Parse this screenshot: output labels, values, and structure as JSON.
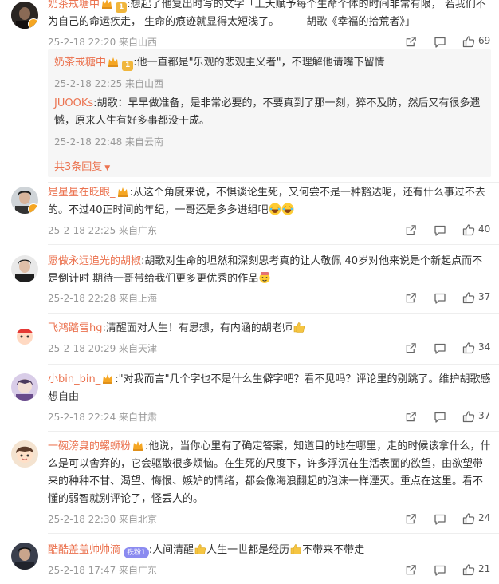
{
  "colors": {
    "username": "#eb7350",
    "meta": "#999999",
    "reply_bg": "#f6f6f6",
    "badge": "#f0b63c"
  },
  "comments": [
    {
      "username": "奶茶戒糖中",
      "badge": "1",
      "text": ":想起了他复出时写的文字「上天赋予每个生命个体的时间非常有限， 若我们不为自己的命运疾走， 生命的痕迹就显得太短浅了。 —— 胡歌《幸福的拾荒者》」",
      "meta": "25-2-18 22:20 来自山西",
      "likes": "69",
      "replies": [
        {
          "username": "奶茶戒糖中",
          "badge": "1",
          "text": ":他一直都是\"乐观的悲观主义者\"，不理解他请嘴下留情",
          "meta": "25-2-18 22:25 来自山西"
        },
        {
          "username": "JUOOKs",
          "text": ":胡歌：早早做准备，是非常必要的，不要真到了那一刻，猝不及防，然后又有很多遗憾，原来人生有好多事都没干成。",
          "meta": "25-2-18 22:48 来自云南"
        }
      ],
      "more_replies": "共3条回复"
    },
    {
      "username": "是星星在眨眼_",
      "text": ":从这个角度来说，不惧谈论生死，又何尝不是一种豁达呢，还有什么事过不去的。不过40正时间的年纪，一哥还是多多进组吧",
      "meta": "25-2-18 22:25 来自广东",
      "likes": "40"
    },
    {
      "username": "愿做永远追光的胡椒",
      "text": ":胡歌对生命的坦然和深刻思考真的让人敬佩 40岁对他来说是个新起点而不是倒计时 期待一哥带给我们更多更优秀的作品",
      "meta": "25-2-18 22:28 来自上海",
      "likes": "37"
    },
    {
      "username": "飞鸿踏雪hg",
      "text": ":清醒面对人生！有思想，有内涵的胡老师",
      "meta": "25-2-18 20:29 来自天津",
      "likes": "34"
    },
    {
      "username": "小bin_bin_",
      "text": ":\"对我而言\"几个字也不是什么生僻字吧？看不见吗？评论里的别跳了。维护胡歌感想自由",
      "meta": "25-2-18 22:24 来自甘肃",
      "likes": "37"
    },
    {
      "username": "一碗滂臭的螺蛳粉",
      "text": ":他说，当你心里有了确定答案，知道目的地在哪里，走的时候该拿什么，什么是可以舍弃的，它会驱散很多烦恼。在生死的尺度下，许多浮沉在生活表面的欲望，由欲望带来的种种不甘、渴望、悔恨、嫉妒的情绪，都会像海浪翻起的泡沫一样湮灭。重点在这里。看不懂的弱智就别评论了，怪丢人的。",
      "meta": "25-2-18 22:30 来自北京",
      "likes": "24"
    },
    {
      "username": "酷酷盖盖帅帅滴",
      "fans_badge": "铁粉1",
      "text_parts": [
        ":人间清醒",
        "人生一世都是经历",
        "不带来不带走"
      ],
      "meta": "25-2-18 17:47 来自广东",
      "likes": "21"
    }
  ]
}
